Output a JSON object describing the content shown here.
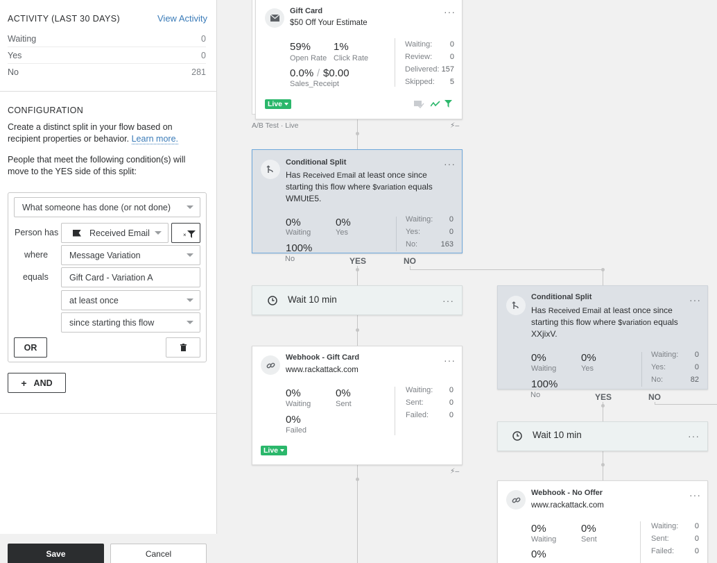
{
  "activity": {
    "title": "ACTIVITY (LAST 30 DAYS)",
    "view_link": "View Activity",
    "rows": [
      {
        "label": "Waiting",
        "value": "0"
      },
      {
        "label": "Yes",
        "value": "0"
      },
      {
        "label": "No",
        "value": "281"
      }
    ]
  },
  "configuration": {
    "title": "CONFIGURATION",
    "desc": "Create a distinct split in your flow based on recipient properties or behavior.",
    "learn_more": "Learn more.",
    "people_text": "People that meet the following condition(s) will move to the YES side of this split:",
    "condition_type": "What someone has done (or not done)",
    "person_has_label": "Person has",
    "metric": "Received Email",
    "where_label": "where",
    "property": "Message Variation",
    "equals_label": "equals",
    "value": "Gift Card - Variation A",
    "frequency": "at least once",
    "timeframe": "since starting this flow",
    "or_label": "OR",
    "and_label": "AND",
    "and_plus": "+"
  },
  "footer": {
    "save": "Save",
    "cancel": "Cancel"
  },
  "canvas": {
    "gift_card": {
      "title": "Gift Card",
      "subtitle": "$50 Off Your Estimate",
      "open_rate": "59%",
      "open_rate_label": "Open Rate",
      "click_rate": "1%",
      "click_rate_label": "Click Rate",
      "conv_rate": "0.0%",
      "conv_sep": "/",
      "revenue": "$0.00",
      "metric_label": "Sales_Receipt",
      "stats": [
        {
          "k": "Waiting:",
          "v": "0"
        },
        {
          "k": "Review:",
          "v": "0"
        },
        {
          "k": "Delivered:",
          "v": "157"
        },
        {
          "k": "Skipped:",
          "v": "5"
        }
      ],
      "status": "Live",
      "ab_label": "A/B Test · Live",
      "bolt": "⚡–"
    },
    "split1": {
      "title": "Conditional Split",
      "text_pre": "Has ",
      "metric": "Received Email",
      "text_mid": " at least once since starting this flow where ",
      "var": "$variation",
      "text_eq": " equals ",
      "value": "WMUtE5.",
      "waiting_pct": "0%",
      "waiting_label": "Waiting",
      "yes_pct": "0%",
      "yes_label": "Yes",
      "no_pct": "100%",
      "no_label": "No",
      "stats": [
        {
          "k": "Waiting:",
          "v": "0"
        },
        {
          "k": "Yes:",
          "v": "0"
        },
        {
          "k": "No:",
          "v": "163"
        }
      ],
      "yes_branch": "YES",
      "no_branch": "NO"
    },
    "wait1": {
      "label": "Wait 10 min"
    },
    "webhook1": {
      "title": "Webhook - Gift Card",
      "url": "www.rackattack.com",
      "waiting_pct": "0%",
      "waiting_label": "Waiting",
      "sent_pct": "0%",
      "sent_label": "Sent",
      "failed_pct": "0%",
      "failed_label": "Failed",
      "stats": [
        {
          "k": "Waiting:",
          "v": "0"
        },
        {
          "k": "Sent:",
          "v": "0"
        },
        {
          "k": "Failed:",
          "v": "0"
        }
      ],
      "status": "Live",
      "bolt": "⚡–"
    },
    "split2": {
      "title": "Conditional Split",
      "text_pre": "Has ",
      "metric": "Received Email",
      "text_mid": " at least once since starting this flow where ",
      "var": "$variation",
      "text_eq": " equals ",
      "value": "XXjixV.",
      "waiting_pct": "0%",
      "waiting_label": "Waiting",
      "yes_pct": "0%",
      "yes_label": "Yes",
      "no_pct": "100%",
      "no_label": "No",
      "stats": [
        {
          "k": "Waiting:",
          "v": "0"
        },
        {
          "k": "Yes:",
          "v": "0"
        },
        {
          "k": "No:",
          "v": "82"
        }
      ],
      "yes_branch": "YES",
      "no_branch": "NO"
    },
    "wait2": {
      "label": "Wait 10 min"
    },
    "webhook2": {
      "title": "Webhook - No Offer",
      "url": "www.rackattack.com",
      "waiting_pct": "0%",
      "waiting_label": "Waiting",
      "sent_pct": "0%",
      "sent_label": "Sent",
      "failed_pct": "0%",
      "stats": [
        {
          "k": "Waiting:",
          "v": "0"
        },
        {
          "k": "Sent:",
          "v": "0"
        },
        {
          "k": "Failed:",
          "v": "0"
        }
      ]
    },
    "menu_glyph": "···",
    "colors": {
      "live": "#2bb76b",
      "split_bg": "#dde1e6",
      "selected_border": "#6ea8dc",
      "link": "#3a7bb8"
    }
  }
}
